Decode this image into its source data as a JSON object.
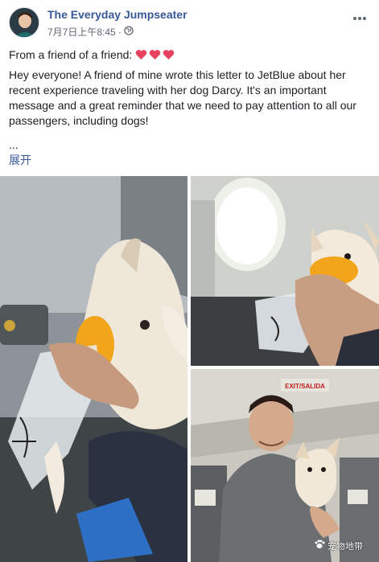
{
  "post": {
    "author": "The Everyday Jumpseater",
    "timestamp": "7月7日上午8:45",
    "separator": "·",
    "audience_icon": "globe-icon",
    "more_icon": "ellipsis-icon",
    "line1": "From a friend of a friend:",
    "heart_color": "#e8425f",
    "body": "Hey everyone! A friend of mine wrote this letter to JetBlue about her recent experience traveling with her dog Darcy. It's an important message and a great reminder that we need to pay attention to all our passengers, including dogs!",
    "ellipsis": "...",
    "expand_label": "展开"
  },
  "photos": {
    "sign_text": "EXIT/SALIDA"
  },
  "watermark": {
    "text": "宠物地带"
  },
  "colors": {
    "link": "#385898",
    "meta": "#606770"
  }
}
